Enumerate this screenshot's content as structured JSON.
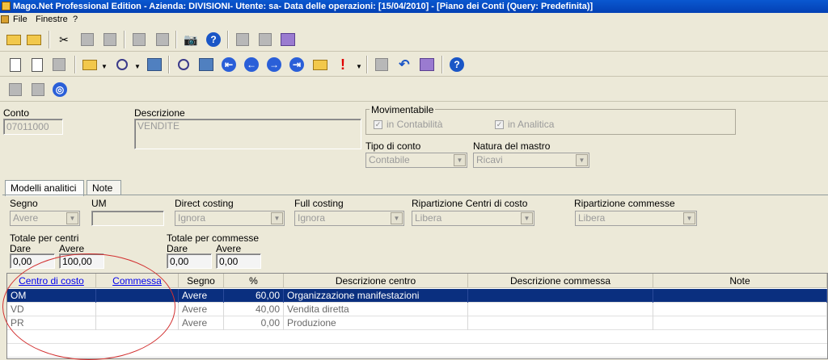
{
  "window": {
    "title": "Mago.Net Professional Edition - Azienda: DIVISIONI- Utente: sa- Data delle operazioni: [15/04/2010] - [Piano dei Conti (Query: Predefinita)]"
  },
  "menu": {
    "items": [
      "File",
      "Finestre",
      "?"
    ]
  },
  "form": {
    "conto_label": "Conto",
    "conto_value": "07011000",
    "descrizione_label": "Descrizione",
    "descrizione_value": "VENDITE",
    "movimentabile_label": "Movimentabile",
    "in_contabilita_label": "in Contabilità",
    "in_analitica_label": "in Analitica",
    "tipo_conto_label": "Tipo di conto",
    "tipo_conto_value": "Contabile",
    "natura_mastro_label": "Natura del mastro",
    "natura_mastro_value": "Ricavi"
  },
  "tabs": [
    "Modelli analitici",
    "Note"
  ],
  "analitici": {
    "segno_label": "Segno",
    "segno_value": "Avere",
    "um_label": "UM",
    "direct_costing_label": "Direct costing",
    "direct_costing_value": "Ignora",
    "full_costing_label": "Full costing",
    "full_costing_value": "Ignora",
    "rip_centri_label": "Ripartizione Centri di costo",
    "rip_centri_value": "Libera",
    "rip_commesse_label": "Ripartizione commesse",
    "rip_commesse_value": "Libera",
    "totale_centri_label": "Totale per centri",
    "totale_commesse_label": "Totale per commesse",
    "dare_label": "Dare",
    "avere_label": "Avere",
    "centri_dare": "0,00",
    "centri_avere": "100,00",
    "commesse_dare": "0,00",
    "commesse_avere": "0,00"
  },
  "grid": {
    "headers": [
      "Centro di costo",
      "Commessa",
      "Segno",
      "%",
      "Descrizione centro",
      "Descrizione commessa",
      "Note"
    ],
    "rows": [
      {
        "centro": "OM",
        "commessa": "",
        "segno": "Avere",
        "pct": "60,00",
        "desc_centro": "Organizzazione manifestazioni",
        "desc_commessa": "",
        "note": ""
      },
      {
        "centro": "VD",
        "commessa": "",
        "segno": "Avere",
        "pct": "40,00",
        "desc_centro": "Vendita diretta",
        "desc_commessa": "",
        "note": ""
      },
      {
        "centro": "PR",
        "commessa": "",
        "segno": "Avere",
        "pct": "0,00",
        "desc_centro": "Produzione",
        "desc_commessa": "",
        "note": ""
      }
    ]
  },
  "colors": {
    "title_bar": "#0a58d0",
    "selected_row": "#0a2f7f",
    "annotation": "#d23030"
  }
}
